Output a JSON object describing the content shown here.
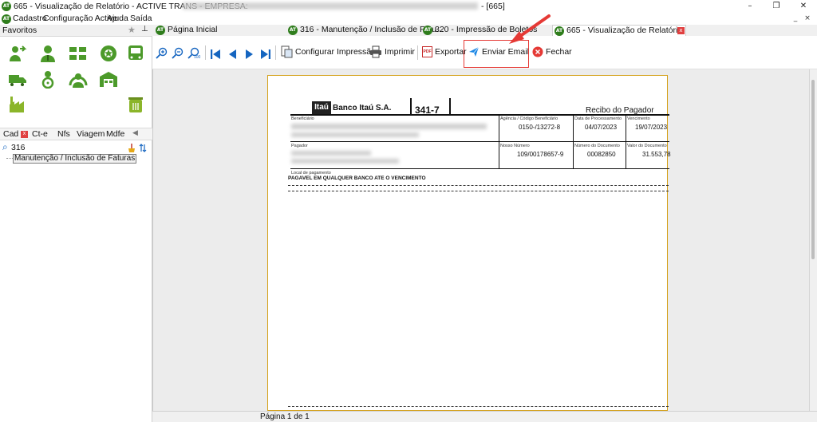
{
  "window": {
    "logo_text": "AT",
    "title": "665 - Visualização de Relatório - ACTIVE TRANS - EMPRESA:",
    "title_suffix": "- [665]",
    "controls": {
      "minimize": "–",
      "restore": "❐",
      "close": "✕"
    }
  },
  "menu": {
    "items": [
      "Cadastro",
      "Configuração Active",
      "Ajuda",
      "Saída"
    ],
    "mdi_min": "_",
    "mdi_close": "×"
  },
  "left_panel": {
    "favorites_label": "Favoritos",
    "pin_icon": "★",
    "pin2_icon": "⊥",
    "tabs": [
      "Cad",
      "Ct-e",
      "Nfs",
      "Viagem",
      "Mdfe"
    ],
    "tab_close": "x",
    "tab_scroll": "◀",
    "search_value": "316",
    "search_icon": "⌕",
    "tree_item": "Manutenção / Inclusão de Faturas"
  },
  "doc_tabs": [
    {
      "label": "Página Inicial"
    },
    {
      "label": "316 - Manutenção / Inclusão de Fatu..."
    },
    {
      "label": "320 - Impressão de Boletos"
    },
    {
      "label": "665 - Visualização de Relatório",
      "active": true
    }
  ],
  "toolbar": {
    "configurar_label": "Configurar Impressão",
    "imprimir_label": "Imprimir",
    "exportar_label": "Exportar",
    "enviar_label": "Enviar Email",
    "fechar_label": "Fechar",
    "pdf_badge": "PDF",
    "zoom_100_label": "100"
  },
  "boleto": {
    "bank_logo": "Itaú",
    "bank_name": "Banco Itaú S.A.",
    "bank_code": "341-7",
    "receipt_title": "Recibo do Pagador",
    "labels": {
      "beneficiario": "Beneficiário",
      "agencia": "Agência / Código Beneficiário",
      "data_proc": "Data de Processamento",
      "vencimento": "Vencimento",
      "pagador": "Pagador",
      "nosso_numero": "Nosso Número",
      "num_doc": "Número do Documento",
      "valor_doc": "Valor do Documento",
      "local": "Local de pagamento"
    },
    "values": {
      "agencia": "0150-/13272-8",
      "data_proc": "04/07/2023",
      "vencimento": "19/07/2023",
      "nosso_numero": "109/00178657-9",
      "num_doc": "00082850",
      "valor_doc": "31.553,78",
      "local": "PAGAVEL EM QUALQUER BANCO ATE O VENCIMENTO"
    }
  },
  "status": {
    "page_text": "Página 1 de 1"
  },
  "colors": {
    "accent_green": "#2f7d1c",
    "highlight_red": "#e53935",
    "page_border": "#d4a017",
    "nav_blue": "#1565c0"
  }
}
